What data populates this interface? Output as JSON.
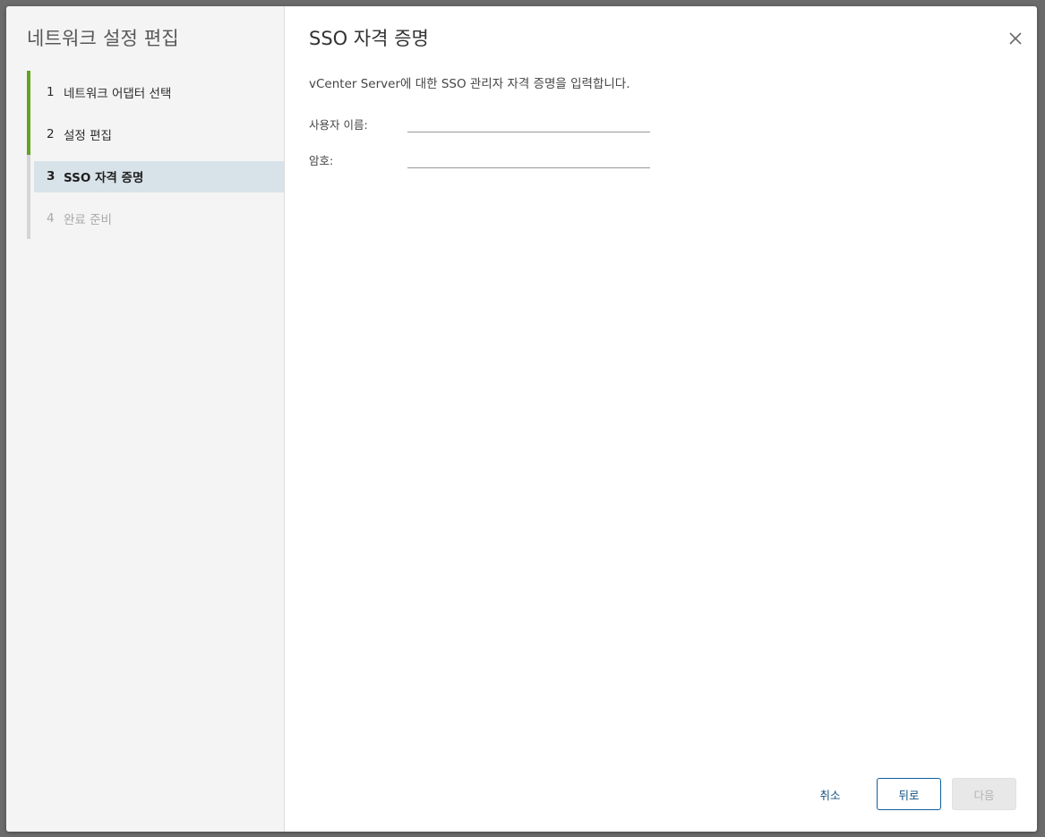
{
  "wizard": {
    "title": "네트워크 설정 편집",
    "steps": [
      {
        "number": "1",
        "label": "네트워크 어댑터 선택",
        "state": "completed"
      },
      {
        "number": "2",
        "label": "설정 편집",
        "state": "completed"
      },
      {
        "number": "3",
        "label": "SSO 자격 증명",
        "state": "current"
      },
      {
        "number": "4",
        "label": "완료 준비",
        "state": "pending"
      }
    ]
  },
  "page": {
    "title": "SSO 자격 증명",
    "description": "vCenter Server에 대한 SSO 관리자 자격 증명을 입력합니다.",
    "close_icon": "close-icon"
  },
  "form": {
    "username": {
      "label": "사용자 이름:",
      "value": ""
    },
    "password": {
      "label": "암호:",
      "value": ""
    }
  },
  "footer": {
    "cancel_label": "취소",
    "back_label": "뒤로",
    "next_label": "다음"
  },
  "colors": {
    "completed_step": "#62a420",
    "pending_step": "#d5d5d5",
    "current_step_highlight": "#d8e3e9",
    "primary_link": "#0f4f80"
  }
}
